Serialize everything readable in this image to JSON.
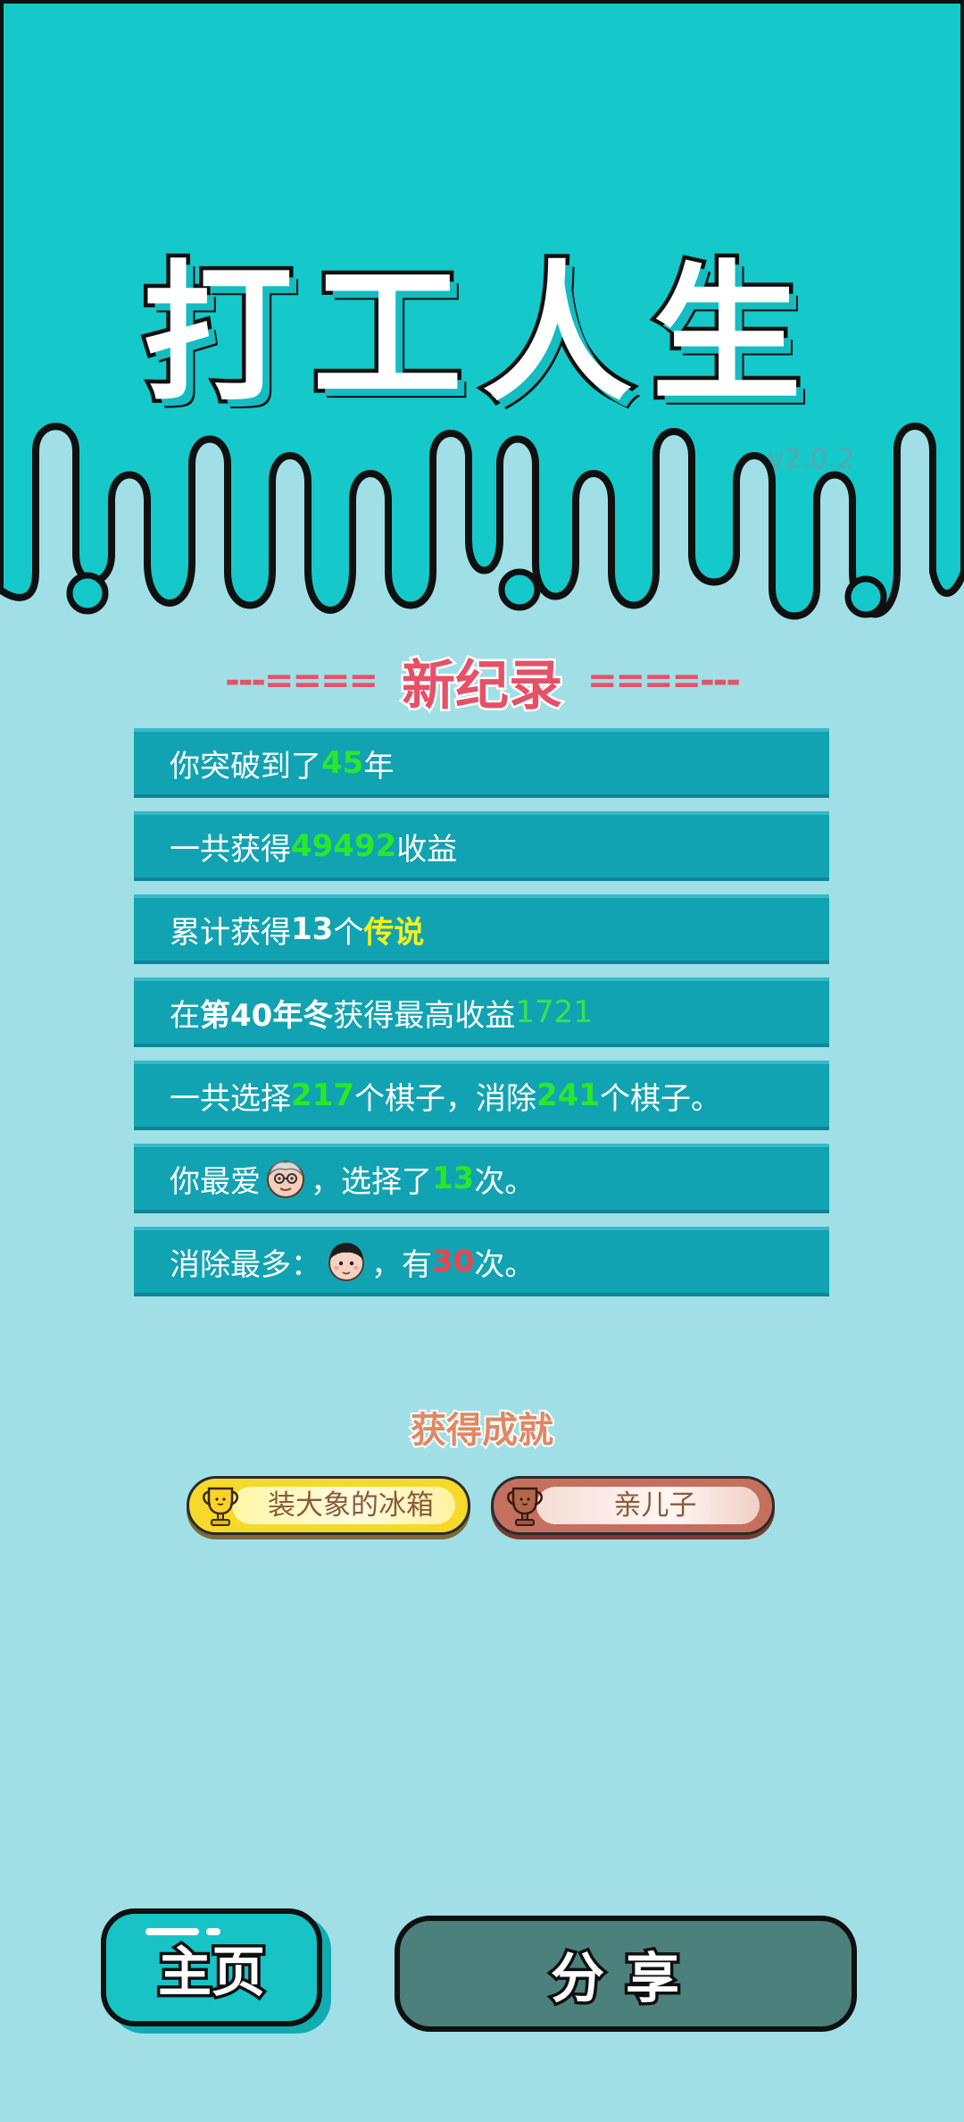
{
  "header": {
    "title": "打工人生",
    "version": "v2.0.2"
  },
  "record": {
    "left_deco": "---====",
    "title": "新纪录",
    "right_deco": "====---"
  },
  "stats": {
    "years": {
      "prefix": "你突破到了",
      "value": "45",
      "suffix": "年"
    },
    "income": {
      "prefix": "一共获得",
      "value": "49492",
      "suffix": "收益"
    },
    "legend": {
      "prefix": "累计获得",
      "count": "13",
      "mid": "个",
      "rank": "传说"
    },
    "best": {
      "prefix": "在 ",
      "season": "第40年冬",
      "mid": " 获得最高收益",
      "value": "1721"
    },
    "pieces": {
      "prefix": "一共选择",
      "selected": "217",
      "mid": "个棋子，消除",
      "removed": "241",
      "suffix": "个棋子。"
    },
    "favorite": {
      "prefix": "你最爱",
      "mid": "，选择了",
      "value": "13",
      "suffix": "次。"
    },
    "most_removed": {
      "prefix": "消除最多：",
      "mid": "，有",
      "value": "30",
      "suffix": "次。"
    }
  },
  "achievements": {
    "title": "获得成就",
    "items": [
      {
        "label": "装大象的冰箱",
        "tier": "gold",
        "icon": "trophy-gold-icon"
      },
      {
        "label": "亲儿子",
        "tier": "bronze",
        "icon": "trophy-bronze-icon"
      }
    ]
  },
  "buttons": {
    "home": "主页",
    "share": "分享"
  },
  "colors": {
    "top_background": "#15c8c9",
    "page_background": "#a1dfe6",
    "stat_row": "#12a3b2",
    "highlight_green": "#28e82a",
    "highlight_yellow": "#f4f11e",
    "highlight_red": "#f0424e",
    "record_pink": "#e65168",
    "home_button": "#18c3c6",
    "share_button": "#4b807c"
  }
}
